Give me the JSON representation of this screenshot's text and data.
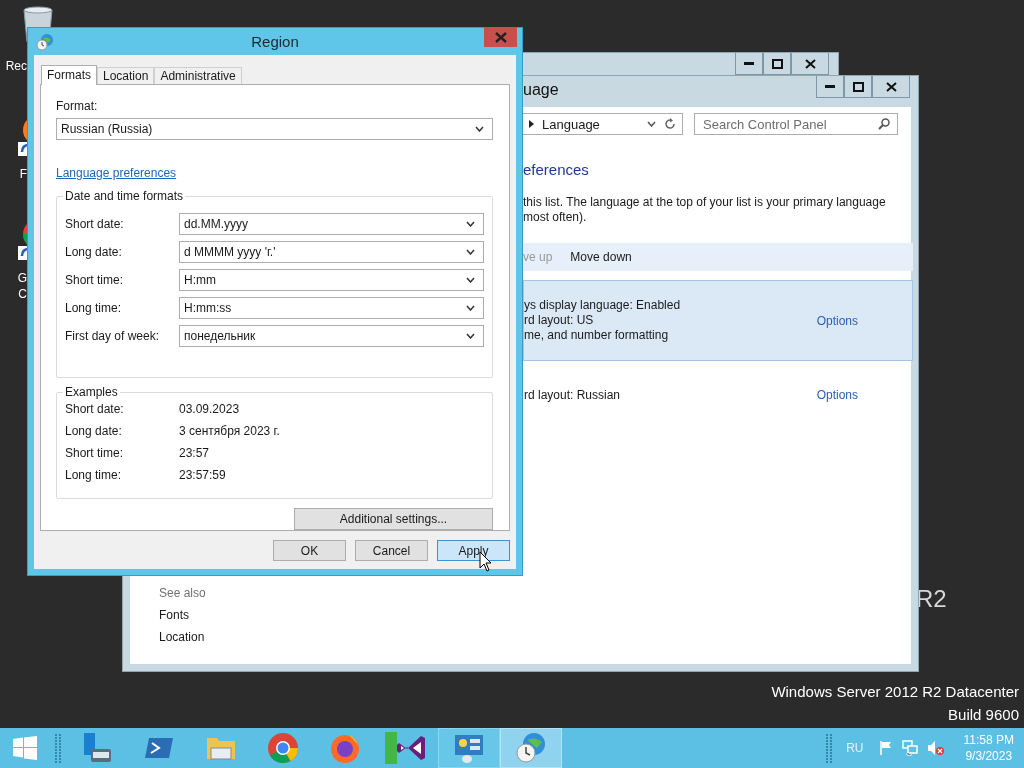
{
  "desktop": {
    "icons": [
      {
        "kind": "recycle-bin",
        "lines": [
          "Rec"
        ]
      },
      {
        "kind": "firefox-shortcut",
        "lines": [
          "F"
        ]
      },
      {
        "kind": "chrome-shortcut",
        "lines": [
          "G",
          "C"
        ]
      }
    ],
    "logo_fragment": "R2",
    "edition": [
      "Windows Server 2012 R2 Datacenter",
      "Build 9600"
    ]
  },
  "language_window": {
    "title": "uage",
    "breadcrumb": "Language",
    "search": {
      "placeholder": "Search Control Panel"
    },
    "heading": "eferences",
    "description": [
      "this list. The language at the top of your list is your primary language",
      "most often)."
    ],
    "toolbar": [
      {
        "label": "ve up",
        "disabled": true
      },
      {
        "label": "Move down",
        "disabled": false
      }
    ],
    "languages": [
      {
        "lines": [
          "ys display language: Enabled",
          "rd layout: US",
          "me, and number formatting"
        ],
        "link": "Options",
        "selected": true
      },
      {
        "lines": [
          "rd layout: Russian"
        ],
        "link": "Options",
        "selected": false
      }
    ],
    "see_also": {
      "title": "See also",
      "links": [
        "Fonts",
        "Location"
      ]
    }
  },
  "region_dialog": {
    "title": "Region",
    "tabs": [
      {
        "label": "Formats",
        "selected": true
      },
      {
        "label": "Location",
        "selected": false
      },
      {
        "label": "Administrative",
        "selected": false
      }
    ],
    "format": {
      "label": "Format:",
      "value": "Russian (Russia)"
    },
    "language_link": "Language preferences",
    "date_time": {
      "title": "Date and time formats",
      "fields": [
        {
          "label": "Short date:",
          "value": "dd.MM.yyyy"
        },
        {
          "label": "Long date:",
          "value": "d MMMM yyyy 'г.'"
        },
        {
          "label": "Short time:",
          "value": "H:mm"
        },
        {
          "label": "Long time:",
          "value": "H:mm:ss"
        },
        {
          "label": "First day of week:",
          "value": "понедельник"
        }
      ]
    },
    "examples": {
      "title": "Examples",
      "rows": [
        {
          "label": "Short date:",
          "value": "03.09.2023"
        },
        {
          "label": "Long date:",
          "value": "3 сентября 2023 г."
        },
        {
          "label": "Short time:",
          "value": "23:57"
        },
        {
          "label": "Long time:",
          "value": "23:57:59"
        }
      ]
    },
    "additional_button": "Additional settings...",
    "buttons": [
      {
        "label": "OK",
        "highlighted": false
      },
      {
        "label": "Cancel",
        "highlighted": false
      },
      {
        "label": "Apply",
        "highlighted": true
      }
    ]
  },
  "taskbar": {
    "apps": [
      {
        "kind": "server-manager",
        "running": false,
        "active": false
      },
      {
        "kind": "powershell",
        "running": false,
        "active": false
      },
      {
        "kind": "explorer",
        "running": false,
        "active": false
      },
      {
        "kind": "chrome",
        "running": false,
        "active": false
      },
      {
        "kind": "firefox",
        "running": false,
        "active": false
      },
      {
        "kind": "visual-studio",
        "running": false,
        "active": false
      },
      {
        "kind": "control-panel",
        "running": true,
        "active": false
      },
      {
        "kind": "region",
        "running": true,
        "active": true
      }
    ],
    "language": "RU",
    "time": "11:58 PM",
    "date": "9/3/2023"
  }
}
